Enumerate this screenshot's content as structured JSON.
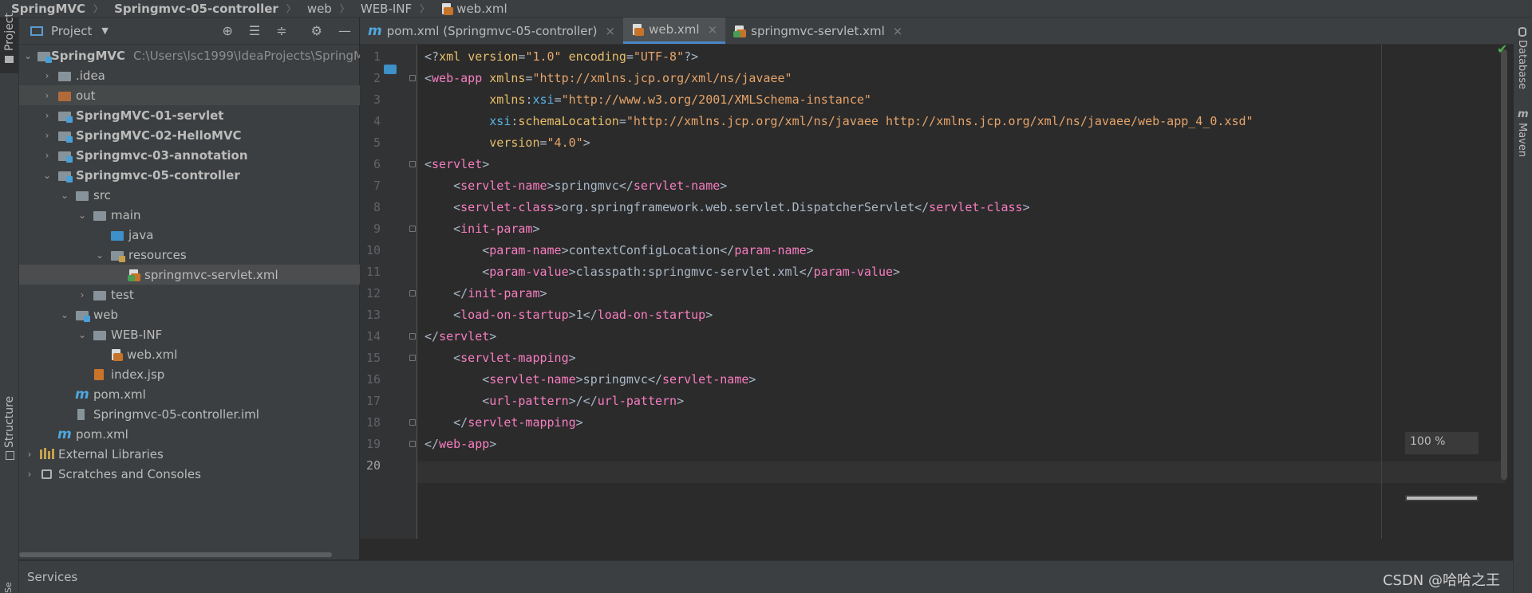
{
  "breadcrumb": [
    "SpringMVC",
    "Springmvc-05-controller",
    "web",
    "WEB-INF",
    "web.xml"
  ],
  "left_stripe": {
    "project": "Project",
    "structure": "Structure",
    "bottom": "Se"
  },
  "right_stripe": {
    "database": "Database",
    "maven": "Maven"
  },
  "project_panel": {
    "title": "Project",
    "tree": [
      {
        "label": "SpringMVC",
        "path": "C:\\Users\\lsc1999\\IdeaProjects\\SpringM",
        "icon": "module-folder-icon",
        "bold": true
      },
      {
        "label": ".idea",
        "icon": "folder-icon"
      },
      {
        "label": "out",
        "icon": "orange-folder-icon"
      },
      {
        "label": "SpringMVC-01-servlet",
        "icon": "module-folder-icon",
        "bold": true
      },
      {
        "label": "SpringMVC-02-HelloMVC",
        "icon": "module-folder-icon",
        "bold": true
      },
      {
        "label": "Springmvc-03-annotation",
        "icon": "module-folder-icon",
        "bold": true
      },
      {
        "label": "Springmvc-05-controller",
        "icon": "module-folder-icon",
        "bold": true
      },
      {
        "label": "src",
        "icon": "folder-icon"
      },
      {
        "label": "main",
        "icon": "folder-icon"
      },
      {
        "label": "java",
        "icon": "blue-folder-icon"
      },
      {
        "label": "resources",
        "icon": "resources-folder-icon"
      },
      {
        "label": "springmvc-servlet.xml",
        "icon": "spring-xml-icon",
        "selected": true
      },
      {
        "label": "test",
        "icon": "folder-icon"
      },
      {
        "label": "web",
        "icon": "web-folder-icon"
      },
      {
        "label": "WEB-INF",
        "icon": "folder-icon"
      },
      {
        "label": "web.xml",
        "icon": "xml-icon"
      },
      {
        "label": "index.jsp",
        "icon": "jsp-icon"
      },
      {
        "label": "pom.xml",
        "icon": "maven-icon"
      },
      {
        "label": "Springmvc-05-controller.iml",
        "icon": "iml-icon"
      },
      {
        "label": "pom.xml",
        "icon": "maven-icon"
      },
      {
        "label": "External Libraries",
        "icon": "libraries-icon"
      },
      {
        "label": "Scratches and Consoles",
        "icon": "scratches-icon"
      }
    ]
  },
  "tabs": [
    {
      "label": "pom.xml (Springmvc-05-controller)",
      "icon": "maven-icon"
    },
    {
      "label": "web.xml",
      "icon": "xml-icon",
      "active": true
    },
    {
      "label": "springmvc-servlet.xml",
      "icon": "spring-xml-icon"
    }
  ],
  "editor": {
    "line_numbers": [
      "1",
      "2",
      "3",
      "4",
      "5",
      "6",
      "7",
      "8",
      "9",
      "10",
      "11",
      "12",
      "13",
      "14",
      "15",
      "16",
      "17",
      "18",
      "19",
      "20"
    ],
    "current_line": "20",
    "zoom": "100 %"
  },
  "bottom": {
    "services": "Services",
    "watermark": "CSDN @哈哈之王"
  },
  "colors": {
    "tag": "#e8bf6a",
    "string": "#6a8759",
    "accent": "#4a88c7"
  }
}
